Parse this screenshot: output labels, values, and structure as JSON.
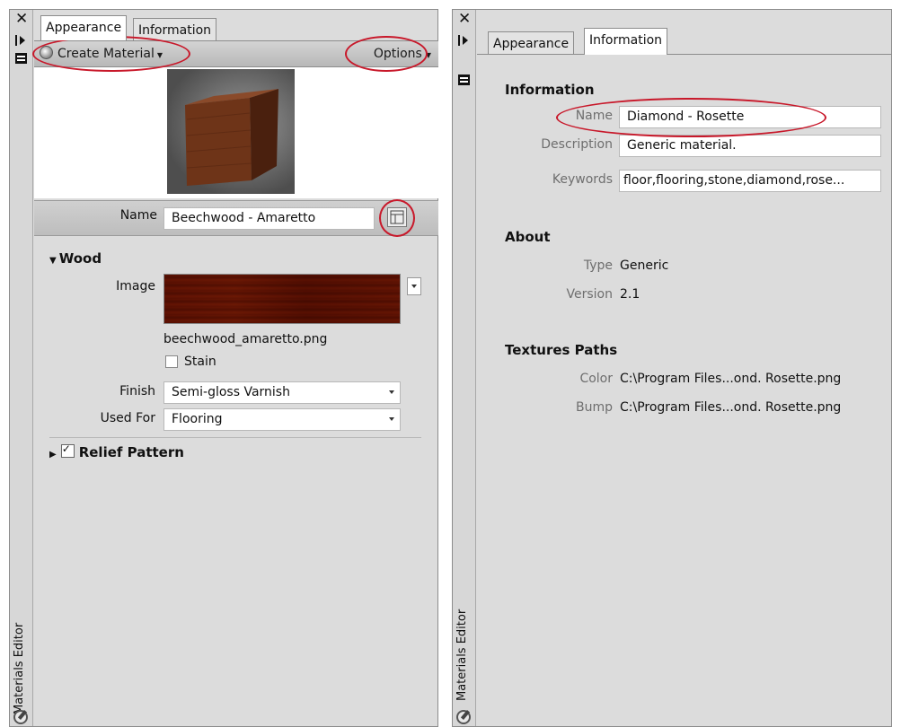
{
  "left": {
    "tabs": [
      "Appearance",
      "Information"
    ],
    "toolbar": {
      "create_material": "Create Material",
      "options": "Options"
    },
    "name_label": "Name",
    "name_value": "Beechwood - Amaretto",
    "wood_section": "Wood",
    "image_label": "Image",
    "image_file": "beechwood_amaretto.png",
    "stain_label": "Stain",
    "stain_checked": false,
    "finish_label": "Finish",
    "finish_value": "Semi-gloss Varnish",
    "used_for_label": "Used For",
    "used_for_value": "Flooring",
    "relief_section": "Relief Pattern",
    "relief_checked": true,
    "side_title": "Materials Editor"
  },
  "right": {
    "tabs": [
      "Appearance",
      "Information"
    ],
    "info_header": "Information",
    "name_label": "Name",
    "name_value": "Diamond - Rosette",
    "description_label": "Description",
    "description_value": "Generic material.",
    "keywords_label": "Keywords",
    "keywords_value": "floor,flooring,stone,diamond,rose...",
    "about_header": "About",
    "type_label": "Type",
    "type_value": "Generic",
    "version_label": "Version",
    "version_value": "2.1",
    "textures_header": "Textures Paths",
    "color_label": "Color",
    "color_value": "C:\\Program Files...ond. Rosette.png",
    "bump_label": "Bump",
    "bump_value": "C:\\Program Files...ond. Rosette.png",
    "side_title": "Materials Editor"
  },
  "colors": {
    "highlight_ring": "#c8182a",
    "panel_bg": "#dcdcdc"
  },
  "icons": [
    "close-icon",
    "pin-icon",
    "properties-icon",
    "material-icon",
    "create-material-icon",
    "swatch-browser-icon"
  ]
}
